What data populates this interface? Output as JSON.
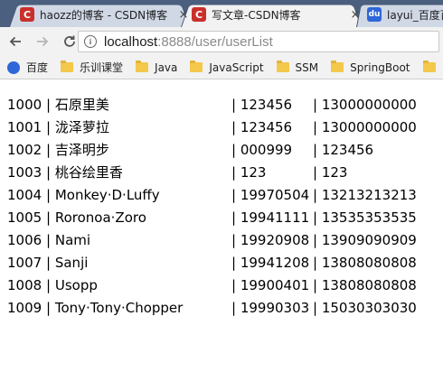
{
  "tabs": [
    {
      "title": "haozz的博客 - CSDN博客",
      "favicon": "C",
      "favicon_name": "csdn-icon",
      "active": false
    },
    {
      "title": "写文章-CSDN博客",
      "favicon": "C",
      "favicon_name": "csdn-icon",
      "active": true
    },
    {
      "title": "layui_百度百",
      "favicon": "du",
      "favicon_name": "baidu-icon",
      "active": false
    }
  ],
  "tab_close": "×",
  "address": {
    "host": "localhost",
    "rest": ":8888/user/userList"
  },
  "bookmarks": [
    {
      "label": "百度",
      "icon": "baidu-paw-icon"
    },
    {
      "label": "乐训课堂",
      "icon": "folder-icon"
    },
    {
      "label": "Java",
      "icon": "folder-icon"
    },
    {
      "label": "JavaScript",
      "icon": "folder-icon"
    },
    {
      "label": "SSM",
      "icon": "folder-icon"
    },
    {
      "label": "SpringBoot",
      "icon": "folder-icon"
    },
    {
      "label": "",
      "icon": "folder-icon"
    }
  ],
  "users": [
    {
      "id": "1000",
      "name": "石原里美",
      "password": "123456",
      "phone": "13000000000"
    },
    {
      "id": "1001",
      "name": "泷泽萝拉",
      "password": "123456",
      "phone": "13000000000"
    },
    {
      "id": "1002",
      "name": "吉泽明步",
      "password": "000999",
      "phone": "123456"
    },
    {
      "id": "1003",
      "name": "桃谷绘里香",
      "password": "123",
      "phone": "123"
    },
    {
      "id": "1004",
      "name": "Monkey·D·Luffy",
      "password": "19970504",
      "phone": "13213213213"
    },
    {
      "id": "1005",
      "name": "Roronoa·Zoro",
      "password": "19941111",
      "phone": "13535353535"
    },
    {
      "id": "1006",
      "name": "Nami",
      "password": "19920908",
      "phone": "13909090909"
    },
    {
      "id": "1007",
      "name": "Sanji",
      "password": "19941208",
      "phone": "13808080808"
    },
    {
      "id": "1008",
      "name": "Usopp",
      "password": "19900401",
      "phone": "13808080808"
    },
    {
      "id": "1009",
      "name": "Tony·Tony·Chopper",
      "password": "19990303",
      "phone": "15030303030"
    }
  ],
  "separator": "|"
}
